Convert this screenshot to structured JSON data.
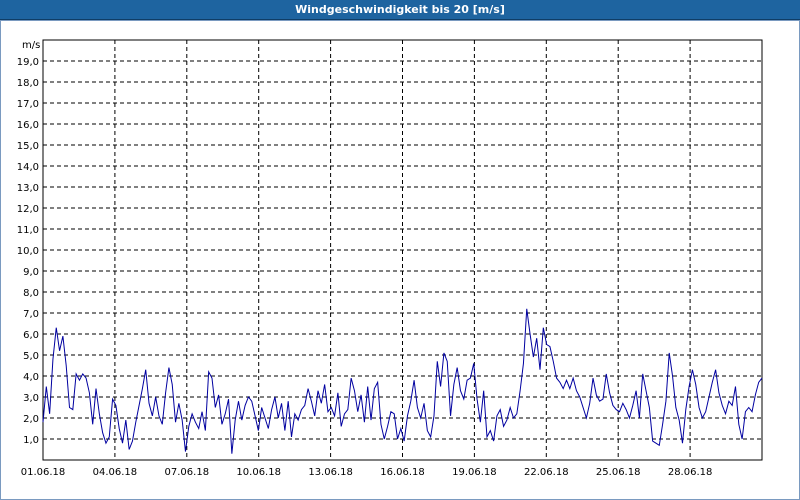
{
  "window": {
    "title": "Windgeschwindigkeit bis 20 [m/s]"
  },
  "chart_data": {
    "type": "line",
    "title": "Windgeschwindigkeit bis 20 [m/s]",
    "ylabel": "m/s",
    "ylim": [
      0,
      20
    ],
    "grid": true,
    "line_color": "#0000a0",
    "xlim": [
      "01.06.18",
      "01.07.18"
    ],
    "xticks": [
      "01.06.18",
      "04.06.18",
      "07.06.18",
      "10.06.18",
      "13.06.18",
      "16.06.18",
      "19.06.18",
      "22.06.18",
      "25.06.18",
      "28.06.18"
    ],
    "yticks": [
      "1,0",
      "2,0",
      "3,0",
      "4,0",
      "5,0",
      "6,0",
      "7,0",
      "8,0",
      "9,0",
      "10,0",
      "11,0",
      "12,0",
      "13,0",
      "14,0",
      "15,0",
      "16,0",
      "17,0",
      "18,0",
      "19,0"
    ],
    "y": [
      1.8,
      3.5,
      2.2,
      4.8,
      6.3,
      5.2,
      5.9,
      4.5,
      2.5,
      2.4,
      4.1,
      3.8,
      4.1,
      3.9,
      3.2,
      1.7,
      3.4,
      2.2,
      1.3,
      0.8,
      1.1,
      2.9,
      2.6,
      1.5,
      0.8,
      1.9,
      0.5,
      0.9,
      1.8,
      2.6,
      3.4,
      4.3,
      2.7,
      2.1,
      3.0,
      2.1,
      1.7,
      3.2,
      4.4,
      3.6,
      1.8,
      2.7,
      1.9,
      0.4,
      1.6,
      2.2,
      1.8,
      1.5,
      2.3,
      1.4,
      4.2,
      3.9,
      2.5,
      3.1,
      1.7,
      2.2,
      2.9,
      0.3,
      1.9,
      2.8,
      1.9,
      2.6,
      3.0,
      2.8,
      2.1,
      1.4,
      2.5,
      2.0,
      1.5,
      2.4,
      3.0,
      2.0,
      2.7,
      1.4,
      2.8,
      1.1,
      2.2,
      1.9,
      2.4,
      2.6,
      3.4,
      2.8,
      2.1,
      3.3,
      2.7,
      3.6,
      2.3,
      2.5,
      2.1,
      3.2,
      1.6,
      2.2,
      2.4,
      3.9,
      3.3,
      2.3,
      3.1,
      1.8,
      3.5,
      1.9,
      3.4,
      3.7,
      1.7,
      1.0,
      1.6,
      2.3,
      2.2,
      1.0,
      1.5,
      0.9,
      2.1,
      2.8,
      3.8,
      2.5,
      2.0,
      2.7,
      1.4,
      1.1,
      2.1,
      4.7,
      3.5,
      5.1,
      4.7,
      2.1,
      3.6,
      4.4,
      3.3,
      2.9,
      3.8,
      3.9,
      4.6,
      2.9,
      1.8,
      3.3,
      1.1,
      1.4,
      0.9,
      2.1,
      2.4,
      1.6,
      1.9,
      2.5,
      2.0,
      2.2,
      3.3,
      4.6,
      7.2,
      6.0,
      4.9,
      5.8,
      4.3,
      6.3,
      5.5,
      5.4,
      4.7,
      3.9,
      3.7,
      3.4,
      3.8,
      3.4,
      3.9,
      3.3,
      3.0,
      2.5,
      2.0,
      2.7,
      3.9,
      3.1,
      2.8,
      2.9,
      4.1,
      3.2,
      2.6,
      2.4,
      2.3,
      2.7,
      2.4,
      2.0,
      2.6,
      3.3,
      2.0,
      4.1,
      3.3,
      2.5,
      0.9,
      0.8,
      0.7,
      1.7,
      2.8,
      5.1,
      4.0,
      2.5,
      1.9,
      0.8,
      2.4,
      3.5,
      4.3,
      3.6,
      2.5,
      2.0,
      2.3,
      3.0,
      3.7,
      4.3,
      3.2,
      2.6,
      2.2,
      2.8,
      2.6,
      3.5,
      1.7,
      1.0,
      2.3,
      2.5,
      2.3,
      3.1,
      3.7,
      3.9
    ]
  }
}
